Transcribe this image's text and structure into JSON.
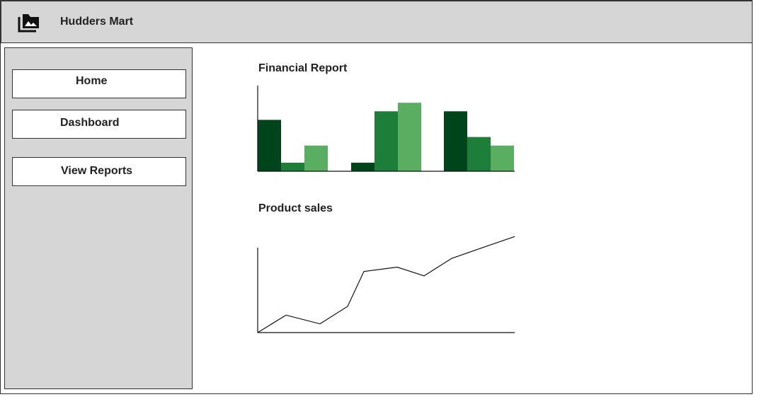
{
  "app": {
    "title": "Hudders Mart",
    "logo_icon": "photo-album-icon"
  },
  "sidebar": {
    "items": [
      {
        "label": "Home"
      },
      {
        "label": "Dashboard"
      },
      {
        "label": "View Reports"
      }
    ]
  },
  "main": {
    "financial_report": {
      "title": "Financial Report"
    },
    "product_sales": {
      "title": "Product sales"
    }
  },
  "colors": {
    "dark_green": "#00441b",
    "mid_green": "#1d7e3a",
    "light_green": "#5aae61",
    "panel_gray": "#d6d6d6"
  },
  "chart_data": [
    {
      "type": "bar",
      "title": "Financial Report",
      "categories": [
        "",
        "",
        ""
      ],
      "series": [
        {
          "color": "#00441b",
          "values": [
            6,
            1,
            7
          ]
        },
        {
          "color": "#1d7e3a",
          "values": [
            1,
            7,
            4
          ]
        },
        {
          "color": "#5aae61",
          "values": [
            3,
            8,
            3
          ]
        }
      ],
      "ylim": [
        0,
        10
      ],
      "grid": false,
      "legend": "none"
    },
    {
      "type": "line",
      "title": "Product sales",
      "x": [
        0,
        1,
        2,
        3,
        4,
        5,
        6,
        7,
        8,
        9
      ],
      "series": [
        {
          "values": [
            0,
            2,
            1,
            3,
            7,
            7.5,
            6.5,
            8.5,
            10,
            11
          ]
        }
      ],
      "ylim": [
        0,
        12
      ],
      "grid": false,
      "legend": "none"
    }
  ]
}
